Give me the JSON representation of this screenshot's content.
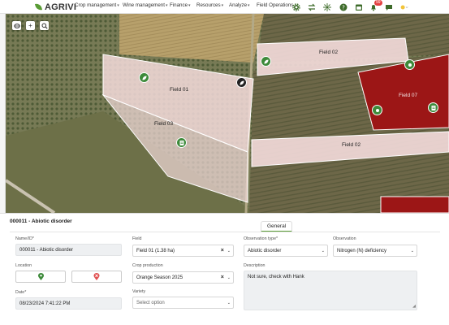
{
  "app": {
    "brand": "AGRIVI"
  },
  "nav": {
    "menus": [
      "Crop management",
      "Wine management",
      "Finance",
      "Resources",
      "Analyze",
      "Field Operations"
    ],
    "notification_count": "99"
  },
  "map": {
    "fields": [
      {
        "label": "Field 01"
      },
      {
        "label": "Field 03"
      },
      {
        "label": "Field 02"
      },
      {
        "label": "Field 07"
      },
      {
        "label": "Field 02"
      }
    ],
    "colors": {
      "field_fill": "#f4dcdc",
      "field_selected": "#9c1616",
      "pin_green": "#3d8a3a"
    }
  },
  "record": {
    "title": "000011 - Abiotic disorder",
    "tab": "General"
  },
  "form": {
    "name_label": "Name/ID*",
    "name_value": "000011 - Abiotic disorder",
    "location_label": "Location",
    "date_label": "Date*",
    "date_value": "08/23/2024 7:41:22 PM",
    "field_label": "Field",
    "field_value": "Field 01 (1.38 ha)",
    "crop_label": "Crop production",
    "crop_value": "Orange Season 2025",
    "variety_label": "Variety",
    "variety_placeholder": "Select option",
    "obs_type_label": "Observation type*",
    "obs_type_value": "Abiotic disorder",
    "observation_label": "Observation",
    "observation_value": "Nitrogen (N) deficiency",
    "description_label": "Description",
    "description_value": "Not sure, check with Hank"
  }
}
